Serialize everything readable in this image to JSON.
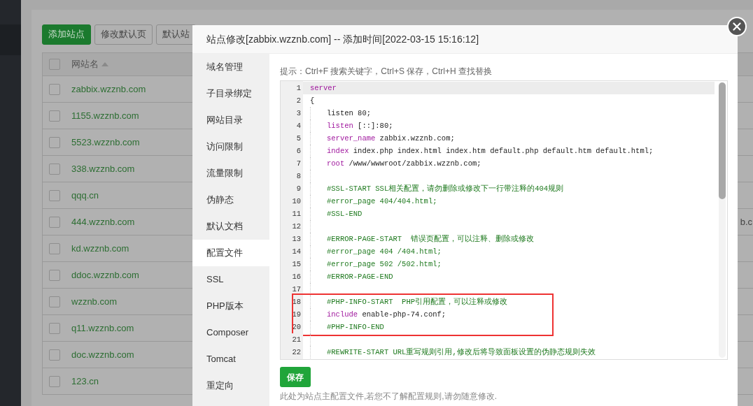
{
  "toolbar": {
    "buttons": [
      {
        "label": "添加站点",
        "kind": "primary"
      },
      {
        "label": "修改默认页",
        "kind": "default"
      },
      {
        "label": "默认站",
        "kind": "default"
      }
    ]
  },
  "table": {
    "select_all": {
      "checked": false
    },
    "columns": [
      {
        "label": "网站名",
        "sorted": true
      }
    ],
    "rows": [
      {
        "name": "zabbix.wzznb.com",
        "checked": false
      },
      {
        "name": "1155.wzznb.com",
        "checked": false
      },
      {
        "name": "5523.wzznb.com",
        "checked": false
      },
      {
        "name": "338.wzznb.com",
        "checked": false
      },
      {
        "name": "qqq.cn",
        "checked": false
      },
      {
        "name": "444.wzznb.com",
        "checked": false,
        "column_2": "b.c"
      },
      {
        "name": "kd.wzznb.com",
        "checked": false
      },
      {
        "name": "ddoc.wzznb.com",
        "checked": false
      },
      {
        "name": "wzznb.com",
        "checked": false
      },
      {
        "name": "q11.wzznb.com",
        "checked": false
      },
      {
        "name": "doc.wzznb.com",
        "checked": false
      },
      {
        "name": "123.cn",
        "checked": false
      }
    ]
  },
  "dialog": {
    "title": "站点修改[zabbix.wzznb.com] -- 添加时间[2022-03-15 15:16:12]",
    "nav": [
      {
        "label": "域名管理",
        "selected": false
      },
      {
        "label": "子目录绑定",
        "selected": false
      },
      {
        "label": "网站目录",
        "selected": false
      },
      {
        "label": "访问限制",
        "selected": false
      },
      {
        "label": "流量限制",
        "selected": false
      },
      {
        "label": "伪静态",
        "selected": false
      },
      {
        "label": "默认文档",
        "selected": false
      },
      {
        "label": "配置文件",
        "selected": true
      },
      {
        "label": "SSL",
        "selected": false
      },
      {
        "label": "PHP版本",
        "selected": false
      },
      {
        "label": "Composer",
        "selected": false
      },
      {
        "label": "Tomcat",
        "selected": false
      },
      {
        "label": "重定向",
        "selected": false
      }
    ],
    "hint": "提示：Ctrl+F 搜索关键字，Ctrl+S 保存，Ctrl+H 查找替换",
    "editor": {
      "lines": [
        {
          "number": "1",
          "current": true,
          "indented": false,
          "boxed": false,
          "segments": [
            {
              "kind": "keyword",
              "text": "server"
            }
          ]
        },
        {
          "number": "2",
          "current": false,
          "indented": false,
          "boxed": false,
          "segments": [
            {
              "kind": "plain",
              "text": "{"
            }
          ]
        },
        {
          "number": "3",
          "current": false,
          "indented": true,
          "boxed": false,
          "segments": [
            {
              "kind": "plain",
              "text": "listen 80;"
            }
          ]
        },
        {
          "number": "4",
          "current": false,
          "indented": true,
          "boxed": false,
          "segments": [
            {
              "kind": "keyword",
              "text": "listen"
            },
            {
              "kind": "plain",
              "text": " [::]:80;"
            }
          ]
        },
        {
          "number": "5",
          "current": false,
          "indented": true,
          "boxed": false,
          "segments": [
            {
              "kind": "keyword",
              "text": "server_name"
            },
            {
              "kind": "plain",
              "text": " zabbix.wzznb.com;"
            }
          ]
        },
        {
          "number": "6",
          "current": false,
          "indented": true,
          "boxed": false,
          "segments": [
            {
              "kind": "keyword",
              "text": "index"
            },
            {
              "kind": "plain",
              "text": " index.php index.html index.htm default.php default.htm default.html;"
            }
          ]
        },
        {
          "number": "7",
          "current": false,
          "indented": true,
          "boxed": false,
          "segments": [
            {
              "kind": "keyword",
              "text": "root"
            },
            {
              "kind": "plain",
              "text": " /www/wwwroot/zabbix.wzznb.com;"
            }
          ]
        },
        {
          "number": "8",
          "current": false,
          "indented": true,
          "boxed": false
        },
        {
          "number": "9",
          "current": false,
          "indented": true,
          "boxed": false,
          "segments": [
            {
              "kind": "comment",
              "text": "#SSL-START SSL相关配置，请勿删除或修改下一行带注释的404规则"
            }
          ]
        },
        {
          "number": "10",
          "current": false,
          "indented": true,
          "boxed": false,
          "segments": [
            {
              "kind": "comment",
              "text": "#error_page 404/404.html;"
            }
          ]
        },
        {
          "number": "11",
          "current": false,
          "indented": true,
          "boxed": false,
          "segments": [
            {
              "kind": "comment",
              "text": "#SSL-END"
            }
          ]
        },
        {
          "number": "12",
          "current": false,
          "indented": true,
          "boxed": false
        },
        {
          "number": "13",
          "current": false,
          "indented": true,
          "boxed": false,
          "segments": [
            {
              "kind": "comment",
              "text": "#ERROR-PAGE-START  错误页配置，可以注释、删除或修改"
            }
          ]
        },
        {
          "number": "14",
          "current": false,
          "indented": true,
          "boxed": false,
          "segments": [
            {
              "kind": "comment",
              "text": "#error_page 404 /404.html;"
            }
          ]
        },
        {
          "number": "15",
          "current": false,
          "indented": true,
          "boxed": false,
          "segments": [
            {
              "kind": "comment",
              "text": "#error_page 502 /502.html;"
            }
          ]
        },
        {
          "number": "16",
          "current": false,
          "indented": true,
          "boxed": false,
          "segments": [
            {
              "kind": "comment",
              "text": "#ERROR-PAGE-END"
            }
          ]
        },
        {
          "number": "17",
          "current": false,
          "indented": true,
          "boxed": false
        },
        {
          "number": "18",
          "current": false,
          "indented": true,
          "boxed": true,
          "segments": [
            {
              "kind": "comment",
              "text": "#PHP-INFO-START  PHP引用配置，可以注释或修改"
            }
          ]
        },
        {
          "number": "19",
          "current": false,
          "indented": true,
          "boxed": true,
          "segments": [
            {
              "kind": "keyword",
              "text": "include"
            },
            {
              "kind": "plain",
              "text": " enable-php-74.conf;"
            }
          ]
        },
        {
          "number": "20",
          "current": false,
          "indented": true,
          "boxed": true,
          "segments": [
            {
              "kind": "comment",
              "text": "#PHP-INFO-END"
            }
          ]
        },
        {
          "number": "21",
          "current": false,
          "indented": true,
          "boxed": false
        },
        {
          "number": "22",
          "current": false,
          "indented": true,
          "boxed": false,
          "segments": [
            {
              "kind": "comment",
              "text": "#REWRITE-START URL重写规则引用,修改后将导致面板设置的伪静态规则失效"
            }
          ]
        }
      ]
    },
    "save_button": "保存",
    "footnote": "此处为站点主配置文件,若您不了解配置规则,请勿随意修改."
  }
}
